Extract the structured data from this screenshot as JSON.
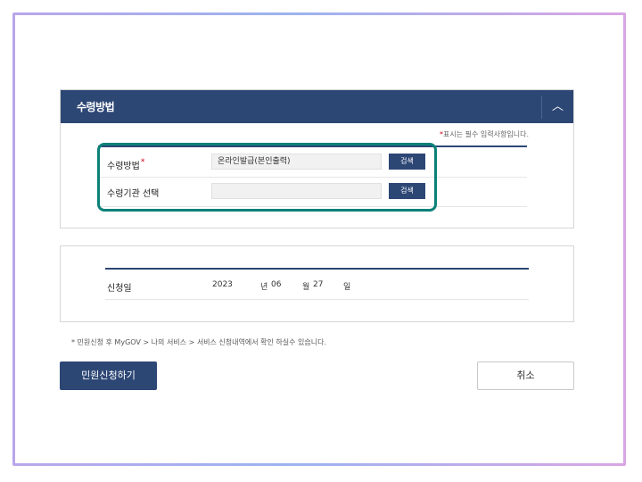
{
  "section": {
    "title": "수령방법",
    "collapse_icon": "chevron-up-icon",
    "collapse_glyph": "︿",
    "required_note_star": "*",
    "required_note": "표시는 필수 입력사항입니다."
  },
  "form": {
    "method_label": "수령방법",
    "method_required_star": "*",
    "method_value": "온라인발급(본인출력)",
    "method_search": "검색",
    "agency_label": "수령기관 선택",
    "agency_value": "",
    "agency_search": "검색"
  },
  "application": {
    "date_label": "신청일",
    "year": "2023",
    "year_unit": "년",
    "month": "06",
    "month_unit": "월",
    "day": "27",
    "day_unit": "일"
  },
  "notice": "* 민원신청 후 MyGOV > 나의 서비스 > 서비스 신청내역에서 확인 하실수 있습니다.",
  "actions": {
    "apply": "민원신청하기",
    "cancel": "취소"
  },
  "colors": {
    "header_bg": "#2d4775",
    "highlight": "#0c8178",
    "required": "#d0021b"
  }
}
